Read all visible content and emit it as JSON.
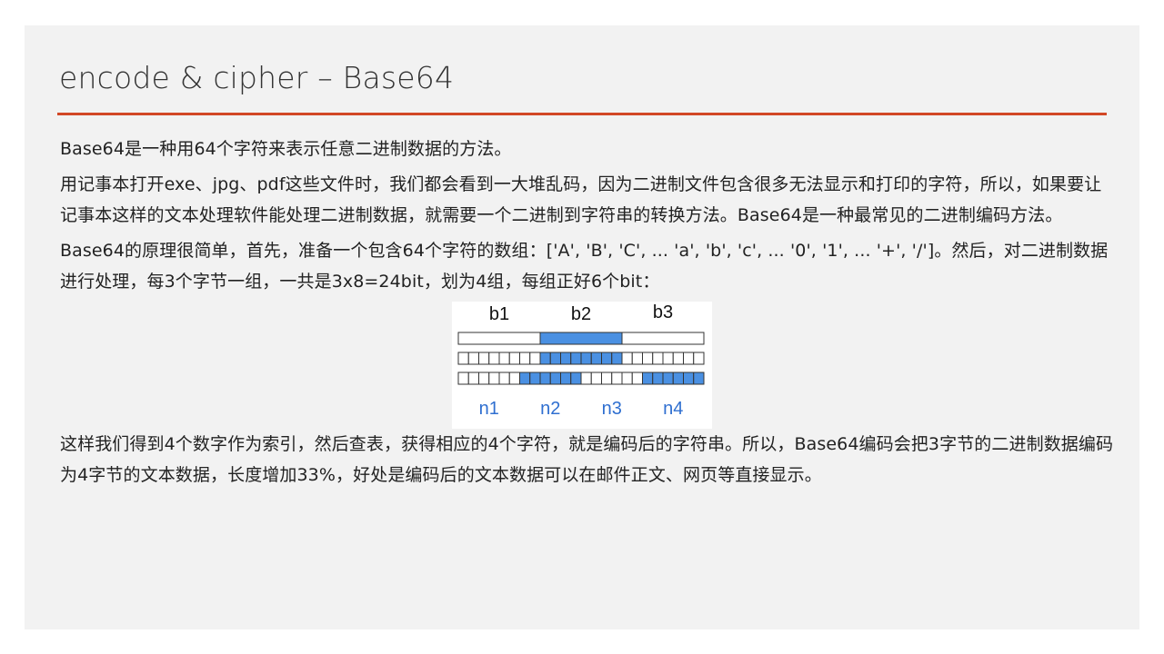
{
  "slide": {
    "title": "encode & cipher – Base64",
    "paragraphs": [
      "Base64是一种用64个字符来表示任意二进制数据的方法。",
      "用记事本打开exe、jpg、pdf这些文件时，我们都会看到一大堆乱码，因为二进制文件包含很多无法显示和打印的字符，所以，如果要让记事本这样的文本处理软件能处理二进制数据，就需要一个二进制到字符串的转换方法。Base64是一种最常见的二进制编码方法。",
      "Base64的原理很简单，首先，准备一个包含64个字符的数组：['A', 'B', 'C', ... 'a', 'b', 'c', ... '0', '1', ... '+', '/']。然后，对二进制数据进行处理，每3个字节一组，一共是3x8=24bit，划为4组，每组正好6个bit：",
      "这样我们得到4个数字作为索引，然后查表，获得相应的4个字符，就是编码后的字符串。所以，Base64编码会把3字节的二进制数据编码为4字节的文本数据，长度增加33%，好处是编码后的文本数据可以在邮件正文、网页等直接显示。"
    ]
  },
  "figure": {
    "bytes": [
      "b1",
      "b2",
      "b3"
    ],
    "groups": [
      "n1",
      "n2",
      "n3",
      "n4"
    ],
    "highlight_color": "#4a90e2",
    "group_label_color": "#2f6fd0",
    "bits_per_byte": 8,
    "bits_per_group": 6
  }
}
